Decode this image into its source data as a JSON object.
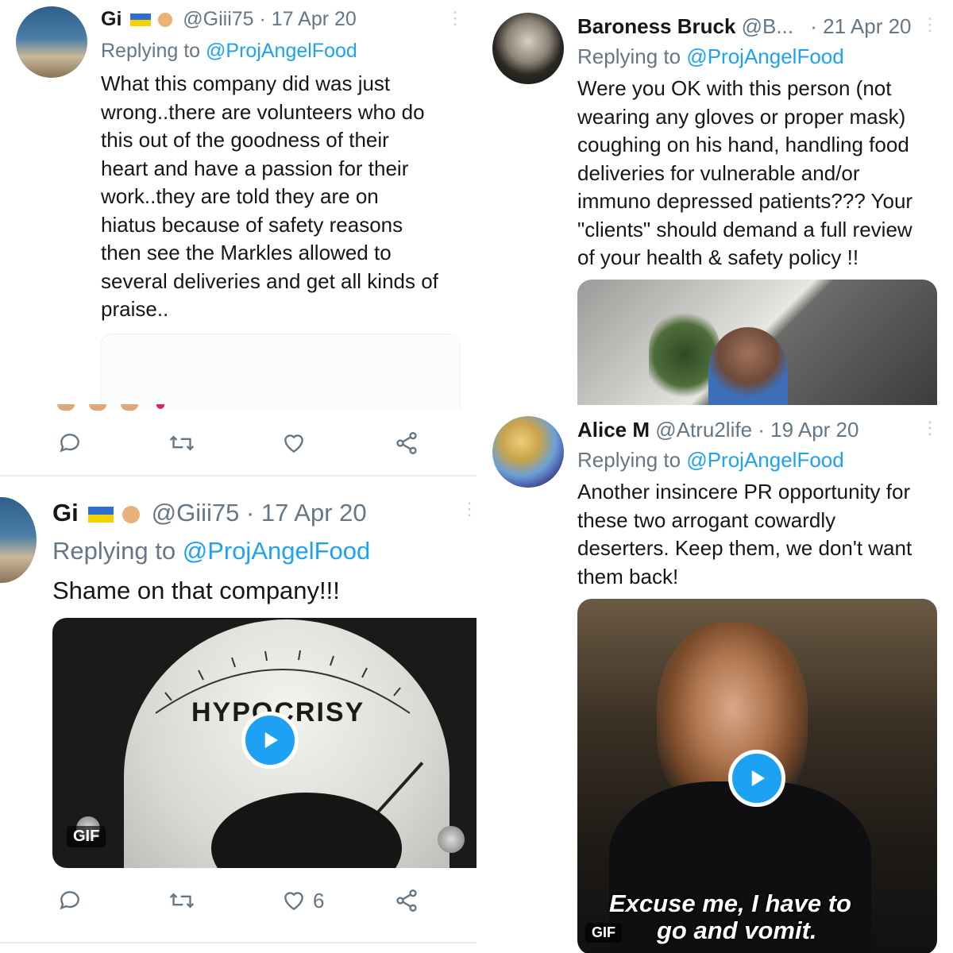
{
  "tweets": [
    {
      "name": "Gi",
      "handle": "@Giii75",
      "date": "· 17 Apr 20",
      "replying_prefix": "Replying to",
      "replying_handle": "@ProjAngelFood",
      "lines": [
        "What this company did was just",
        "wrong..there are volunteers who do",
        "this out of the goodness of their",
        "heart and have a passion for their",
        "work..they are told they are on",
        "hiatus because of safety reasons",
        "then see the Markles allowed to",
        "several deliveries and get all kinds of",
        "praise.."
      ]
    },
    {
      "name": "Baroness Bruck",
      "handle": "@B...",
      "date": "· 21 Apr 20",
      "replying_prefix": "Replying to",
      "replying_handle": "@ProjAngelFood",
      "lines": [
        "Were you OK with this person (not",
        "wearing any gloves or proper mask)",
        "coughing on his hand, handling food",
        "deliveries for vulnerable and/or",
        "immuno depressed patients??? Your",
        "\"clients\" should demand a full review",
        "of your health & safety policy !!"
      ]
    },
    {
      "name": "Gi",
      "handle": "@Giii75",
      "date": "· 17 Apr 20",
      "replying_prefix": "Replying to",
      "replying_handle": "@ProjAngelFood",
      "lines": [
        "Shame on that company!!!"
      ],
      "media": {
        "meter_label": "HYPOCRISY",
        "badge": "GIF"
      },
      "like_count": "6"
    },
    {
      "name": "Alice M",
      "handle": "@Atru2life",
      "date": "· 19 Apr 20",
      "replying_prefix": "Replying to",
      "replying_handle": "@ProjAngelFood",
      "lines": [
        "Another insincere PR opportunity for",
        "these two arrogant cowardly",
        "deserters. Keep them, we don't want",
        "them back!"
      ],
      "media": {
        "caption_1": "Excuse me, I have to",
        "caption_2": "go and vomit.",
        "badge": "GIF"
      }
    }
  ],
  "icons": {
    "reply": "reply-icon",
    "retweet": "retweet-icon",
    "like": "heart-icon",
    "share": "share-icon",
    "more": "more-options-icon",
    "play": "play-icon",
    "flags": "ukraine-flag-icon, raised-fist-icon"
  },
  "colors": {
    "link": "#1da1f2",
    "muted": "#657786",
    "divider": "#e6ecf0"
  }
}
